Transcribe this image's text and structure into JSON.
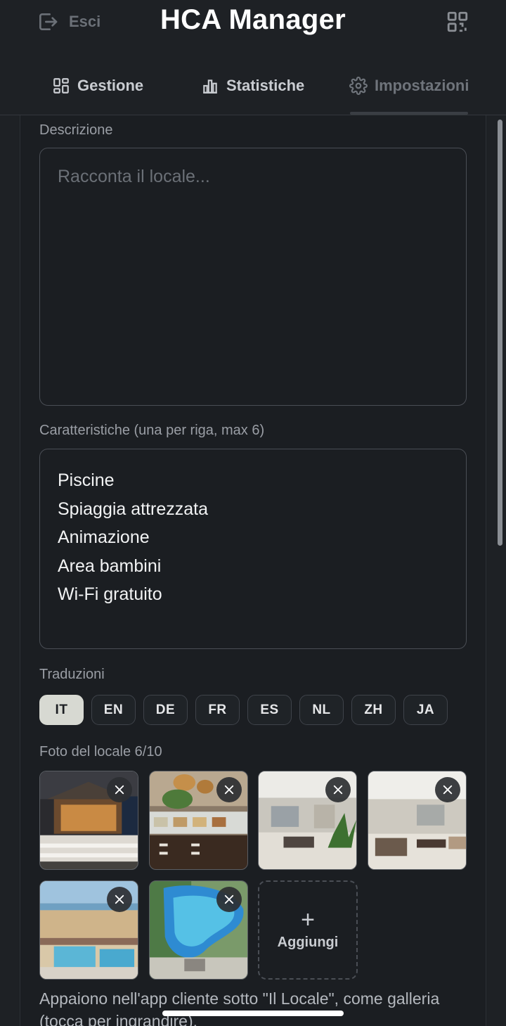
{
  "header": {
    "exit_label": "Esci",
    "title": "HCA Manager",
    "qr_icon": "qr-code-icon"
  },
  "tabs": [
    {
      "label": "Gestione",
      "icon": "grid-icon"
    },
    {
      "label": "Statistiche",
      "icon": "bar-chart-icon"
    },
    {
      "label": "Impostazioni",
      "icon": "gear-icon",
      "active": true
    }
  ],
  "description": {
    "label": "Descrizione",
    "placeholder": "Racconta il locale..."
  },
  "features": {
    "label": "Caratteristiche (una per riga, max 6)",
    "items": [
      "Piscine",
      "Spiaggia attrezzata",
      "Animazione",
      "Area bambini",
      "Wi-Fi gratuito"
    ]
  },
  "translations": {
    "label": "Traduzioni",
    "languages": [
      "IT",
      "EN",
      "DE",
      "FR",
      "ES",
      "NL",
      "ZH",
      "JA"
    ],
    "active": "IT"
  },
  "photos": {
    "label": "Foto del locale 6/10",
    "items": [
      "hotel-terrace-photo",
      "buffet-restaurant-photo",
      "hotel-lobby-photo",
      "hotel-lounge-photo",
      "beach-pool-aerial-photo",
      "pool-aerial-photo"
    ],
    "add_label": "Aggiungi",
    "add_icon": "+",
    "hint": "Appaiono nell'app cliente sotto \"Il Locale\", come galleria (tocca per ingrandire)."
  },
  "colors": {
    "background": "#1e2125",
    "active_pill": "#d7d9d2"
  }
}
